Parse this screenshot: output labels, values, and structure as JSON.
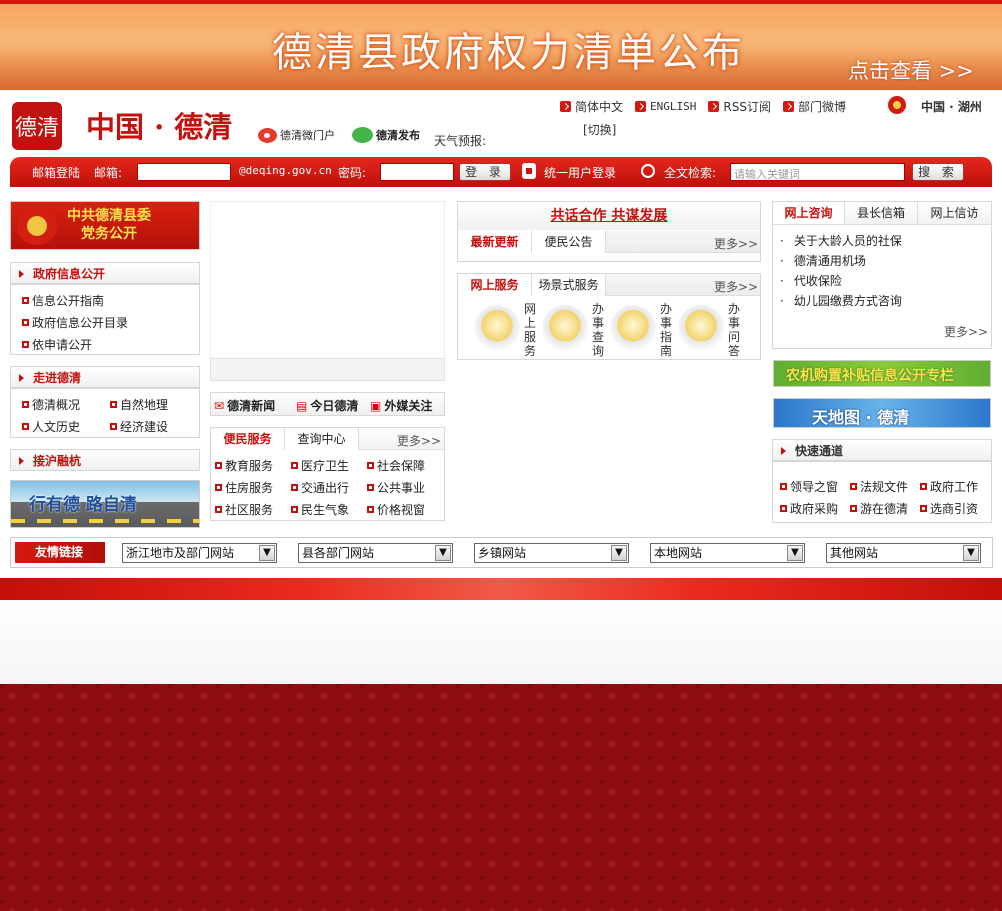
{
  "banner": {
    "title": "德清县政府权力清单公布",
    "more": "点击查看 >>"
  },
  "header": {
    "logo_text": "德清",
    "site_name": "中国 · 德清",
    "weibo_label": "德清微门户",
    "wechat_label": "德清发布",
    "weather_label": "天气预报:",
    "links": [
      "简体中文",
      "ENGLISH",
      "RSS订阅",
      "部门微博"
    ],
    "switch_label": "[切换]",
    "region": "中国 · 湖州"
  },
  "login": {
    "title": "邮箱登陆",
    "mailbox_label": "邮箱:",
    "domain": "@deqing.gov.cn",
    "password_label": "密码:",
    "login_button": "登 录",
    "unified_login": "统一用户登录",
    "search_label": "全文检索:",
    "search_placeholder": "请输入关键词",
    "search_button": "搜 索"
  },
  "left": {
    "party_banner": "中共德清县委\n党务公开",
    "gov_info_title": "政府信息公开",
    "gov_info_items": [
      "信息公开指南",
      "政府信息公开目录",
      "依申请公开"
    ],
    "deqing_title": "走进德清",
    "deqing_items": [
      "德清概况",
      "自然地理",
      "人文历史",
      "经济建设"
    ],
    "shanghai_title": "接沪融杭",
    "road_banner": "行有德 路自清"
  },
  "middle": {
    "news_tabs": [
      "德清新闻",
      "今日德清",
      "外媒关注"
    ],
    "service_tabs": [
      "便民服务",
      "查询中心"
    ],
    "service_more": "更多>>",
    "service_items": [
      "教育服务",
      "医疗卫生",
      "社会保障",
      "住房服务",
      "交通出行",
      "公共事业",
      "社区服务",
      "民生气象",
      "价格视窗"
    ]
  },
  "center": {
    "slogan": "共话合作 共谋发展",
    "update_tabs": [
      "最新更新",
      "便民公告"
    ],
    "update_more": "更多>>",
    "online_tabs": [
      "网上服务",
      "场景式服务"
    ],
    "online_more": "更多>>",
    "services": [
      "网上服务",
      "办事查询",
      "办事指南",
      "办事问答"
    ]
  },
  "right": {
    "tabs": [
      "网上咨询",
      "县长信箱",
      "网上信访"
    ],
    "items": [
      "关于大龄人员的社保",
      "德清通用机场",
      "代收保险",
      "幼儿园缴费方式咨询"
    ],
    "more": "更多>>",
    "banner1": "农机购置补贴信息公开专栏",
    "banner2": "天地图 · 德清",
    "quick_title": "快速通道",
    "quick_items": [
      "领导之窗",
      "法规文件",
      "政府工作",
      "政府采购",
      "游在德清",
      "选商引资"
    ]
  },
  "friends": {
    "label": "友情链接",
    "selects": [
      "浙江地市及部门网站",
      "县各部门网站",
      "乡镇网站",
      "本地网站",
      "其他网站"
    ]
  },
  "colors": {
    "brand_red": "#c5110d",
    "bar_red": "#d6190f",
    "footer_red": "#8e0d10"
  }
}
